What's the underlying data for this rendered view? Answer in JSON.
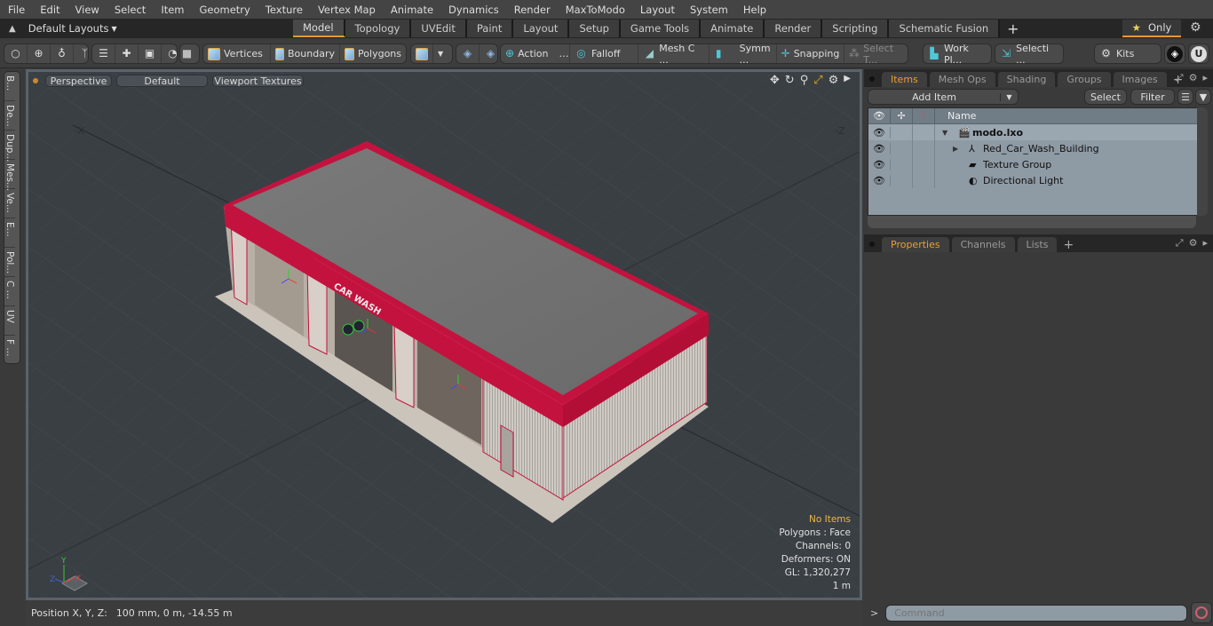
{
  "menubar": [
    "File",
    "Edit",
    "View",
    "Select",
    "Item",
    "Geometry",
    "Texture",
    "Vertex Map",
    "Animate",
    "Dynamics",
    "Render",
    "MaxToModo",
    "Layout",
    "System",
    "Help"
  ],
  "layouts": {
    "label": "Default Layouts"
  },
  "tabs": [
    {
      "label": "Model",
      "active": true
    },
    {
      "label": "Topology"
    },
    {
      "label": "UVEdit"
    },
    {
      "label": "Paint"
    },
    {
      "label": "Layout"
    },
    {
      "label": "Setup"
    },
    {
      "label": "Game Tools"
    },
    {
      "label": "Animate"
    },
    {
      "label": "Render"
    },
    {
      "label": "Scripting"
    },
    {
      "label": "Schematic Fusion"
    }
  ],
  "only_label": "Only",
  "toolbar": {
    "vertices": "Vertices",
    "boundary": "Boundary",
    "polygons": "Polygons",
    "action": "Action",
    "falloff": "Falloff",
    "mesh_c": "Mesh C ...",
    "symm": "Symm ...",
    "snapping": "Snapping",
    "select_t": "Select T...",
    "work_pl": "Work Pl...",
    "selecti": "Selecti ...",
    "kits": "Kits"
  },
  "left_tabs": [
    "B...",
    "De...",
    "Dup...",
    "Mes...",
    "Ve...",
    "E...",
    "Pol...",
    "C ...",
    "UV",
    "F ..."
  ],
  "viewport": {
    "perspective": "Perspective",
    "default": "Default",
    "textures": "Viewport Textures",
    "axis_x": "-X",
    "axis_z": "-Z",
    "info": {
      "selection": "No Items",
      "polygons": "Polygons : Face",
      "channels": "Channels: 0",
      "deformers": "Deformers: ON",
      "gl": "GL: 1,320,277",
      "scale": "1 m"
    },
    "sign_text": "CAR WASH"
  },
  "status": {
    "label": "Position X, Y, Z:",
    "value": "100 mm, 0 m, -14.55 m"
  },
  "items_panel": {
    "tabs": [
      "Items",
      "Mesh Ops",
      "Shading",
      "Groups",
      "Images"
    ],
    "add_item": "Add Item",
    "select": "Select",
    "filter": "Filter",
    "column_name": "Name",
    "rows": [
      {
        "name": "modo.lxo",
        "icon": "scene-icon",
        "bold": true
      },
      {
        "name": "Red_Car_Wash_Building",
        "icon": "mesh-locator-icon"
      },
      {
        "name": "Texture Group",
        "icon": "texture-group-icon"
      },
      {
        "name": "Directional Light",
        "icon": "light-icon"
      }
    ]
  },
  "props_panel": {
    "tabs": [
      "Properties",
      "Channels",
      "Lists"
    ]
  },
  "command": {
    "placeholder": "Command"
  }
}
